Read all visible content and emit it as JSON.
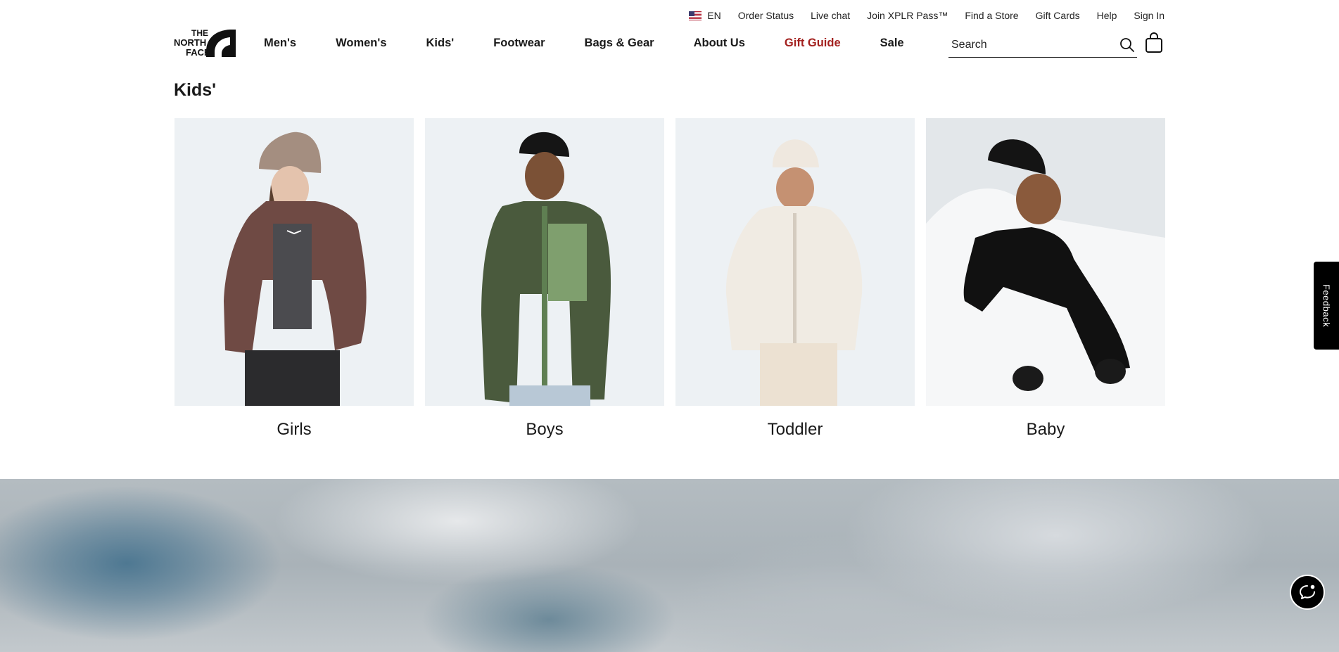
{
  "utility_nav": {
    "language": "EN",
    "links": [
      "Order Status",
      "Live chat",
      "Join XPLR Pass™",
      "Find a Store",
      "Gift Cards",
      "Help",
      "Sign In"
    ]
  },
  "logo": {
    "lines": [
      "THE",
      "NORTH",
      "FACE"
    ]
  },
  "main_nav": [
    "Men's",
    "Women's",
    "Kids'",
    "Footwear",
    "Bags & Gear",
    "About Us",
    "Gift Guide",
    "Sale"
  ],
  "search": {
    "placeholder": "Search",
    "value": ""
  },
  "section": {
    "title": "Kids'"
  },
  "categories": [
    {
      "label": "Girls",
      "icon": "girl-model-photo"
    },
    {
      "label": "Boys",
      "icon": "boy-model-photo"
    },
    {
      "label": "Toddler",
      "icon": "toddler-model-photo"
    },
    {
      "label": "Baby",
      "icon": "baby-model-photo"
    }
  ],
  "feedback_tab": {
    "label": "Feedback"
  },
  "colors": {
    "gift_guide": "#a3211f",
    "card_bg": "#edf1f4"
  }
}
